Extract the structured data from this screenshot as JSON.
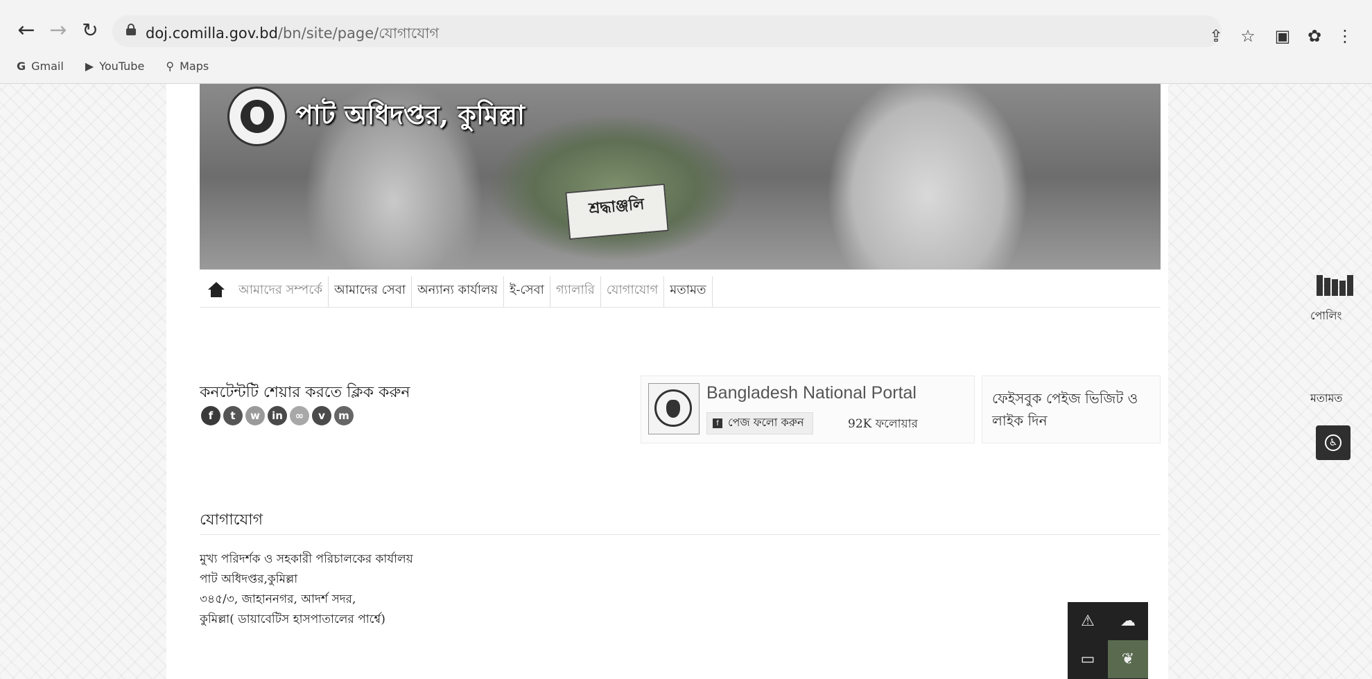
{
  "browser": {
    "url_host": "doj.comilla.gov.bd",
    "url_path": "/bn/site/page/যোগাযোগ",
    "bookmarks": [
      {
        "icon": "G",
        "label": "Gmail"
      },
      {
        "icon": "▶",
        "label": "YouTube"
      },
      {
        "icon": "⚲",
        "label": "Maps"
      }
    ]
  },
  "header": {
    "site_title": "পাট অধিদপ্তর, কুমিল্লা",
    "banner_card_text": "শ্রদ্ধাঞ্জলি"
  },
  "menu": {
    "items": [
      {
        "label": "আমাদের সম্পর্কে",
        "muted": true
      },
      {
        "label": "আমাদের সেবা",
        "muted": false
      },
      {
        "label": "অন্যান্য কার্যালয়",
        "muted": false
      },
      {
        "label": "ই-সেবা",
        "muted": false
      },
      {
        "label": "গ্যালারি",
        "muted": true
      },
      {
        "label": "যোগাযোগ",
        "muted": true
      },
      {
        "label": "মতামত",
        "muted": false
      }
    ]
  },
  "share": {
    "heading": "কনটেন্টটি শেয়ার করতে ক্লিক করুন",
    "icons": [
      {
        "name": "facebook-icon",
        "glyph": "f",
        "color": "#3a3a3a"
      },
      {
        "name": "twitter-icon",
        "glyph": "t",
        "color": "#555555"
      },
      {
        "name": "whatsapp-icon",
        "glyph": "w",
        "color": "#9a9a9a"
      },
      {
        "name": "linkedin-icon",
        "glyph": "in",
        "color": "#4a4a4a"
      },
      {
        "name": "link-icon",
        "glyph": "∞",
        "color": "#a8a8a8"
      },
      {
        "name": "viber-icon",
        "glyph": "v",
        "color": "#4a4a4a"
      },
      {
        "name": "messenger-icon",
        "glyph": "m",
        "color": "#666666"
      }
    ]
  },
  "facebook_box": {
    "page_name": "Bangladesh National Portal",
    "follow_label": "পেজ ফলো করুন",
    "followers": "92K ফলোয়ার"
  },
  "facebook_visit": {
    "text": "ফেইসবুক পেইজ ভিজিট ও লাইক দিন"
  },
  "contact": {
    "title": "যোগাযোগ",
    "lines": [
      "মুখ্য পরিদর্শক ও সহকারী পরিচালকের কার্যালয়",
      "পাট অধিদপ্তর,কুমিল্লা",
      "৩৪৫/৩, জাহাননগর, আদর্শ সদর,",
      "কুমিল্লা( ডায়াবেটিস হাসপাতালের পার্শ্বে)"
    ]
  },
  "side_tools": {
    "polling_label": "পোলিং",
    "feedback_label": "মতামত"
  }
}
